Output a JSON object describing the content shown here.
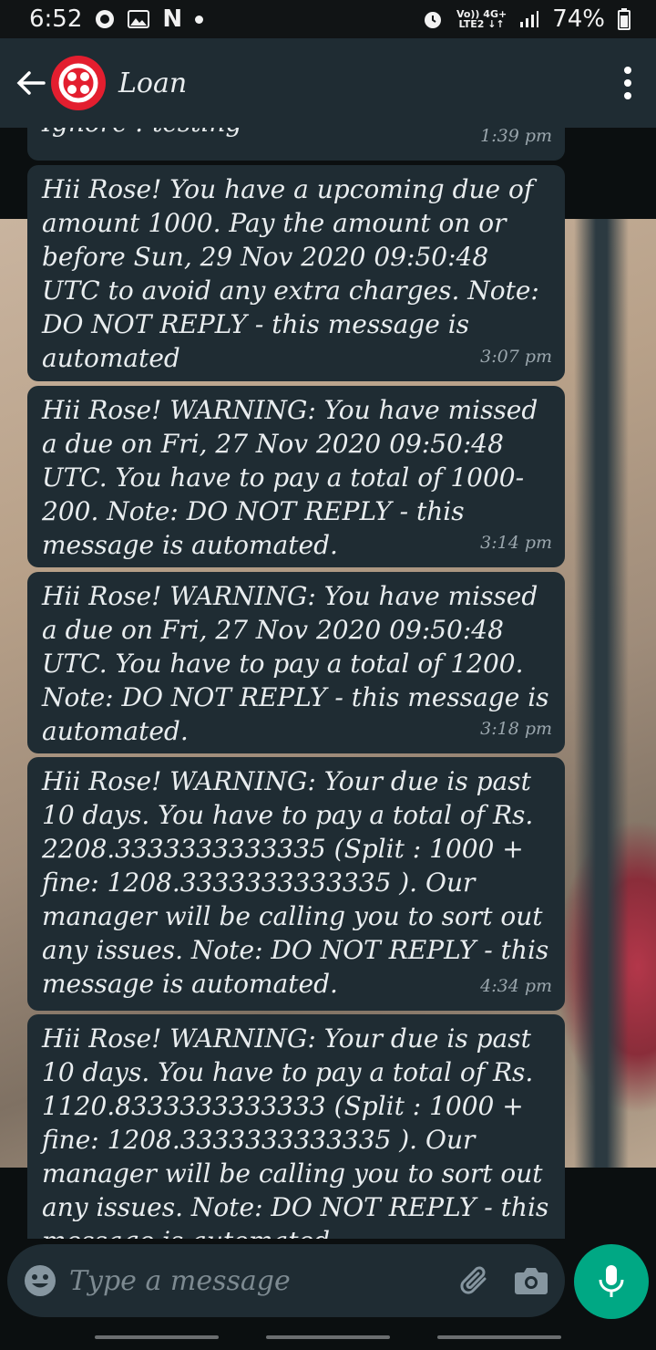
{
  "status_bar": {
    "time": "6:52",
    "notif_n": "N",
    "network_top": "Vo)) 4G+",
    "network_bottom": "LTE2 ↓↑",
    "battery": "74%",
    "battery_level": 0.74
  },
  "header": {
    "title": "Loan"
  },
  "messages": [
    {
      "text": "Ignore : testing",
      "time": "1:39 pm"
    },
    {
      "text": "Hii Rose! You have a upcoming due of amount 1000. Pay the amount on or before Sun, 29 Nov 2020 09:50:48 UTC to avoid any extra charges. Note: DO NOT REPLY - this message is automated",
      "time": "3:07 pm"
    },
    {
      "text": "Hii Rose! WARNING: You have missed a due on Fri, 27 Nov 2020 09:50:48 UTC. You have to pay a total of 1000-200. Note: DO NOT REPLY - this message is automated.",
      "time": "3:14 pm"
    },
    {
      "text": "Hii Rose! WARNING: You have missed a due on Fri, 27 Nov 2020 09:50:48 UTC. You have to pay a total of 1200. Note: DO NOT REPLY - this message is automated.",
      "time": "3:18 pm"
    },
    {
      "text": "Hii Rose! WARNING: Your due is past 10 days. You have to pay a total of Rs. 2208.3333333333335 (Split : 1000 + fine: 1208.3333333333335 ). Our manager will be calling you to sort out any issues. Note: DO NOT REPLY - this message is automated.",
      "time": "4:34 pm"
    },
    {
      "text": "Hii Rose! WARNING: Your due is past 10 days. You have to pay a total of Rs. 1120.8333333333333 (Split : 1000 + fine: 1208.3333333333335 ). Our manager will be calling you to sort out any issues. Note: DO NOT REPLY - this message is automated.",
      "time": ""
    }
  ],
  "composer": {
    "placeholder": "Type a message"
  },
  "icons": {
    "back": "arrow-left-icon",
    "avatar": "twilio-logo-icon",
    "menu": "more-vertical-icon",
    "emoji": "emoji-icon",
    "attach": "paperclip-icon",
    "camera": "camera-icon",
    "mic": "microphone-icon"
  },
  "colors": {
    "app_bar": "#1f2c33",
    "bubble": "#1f2c33",
    "mic_button": "#00a884",
    "avatar": "#e31e2f"
  }
}
